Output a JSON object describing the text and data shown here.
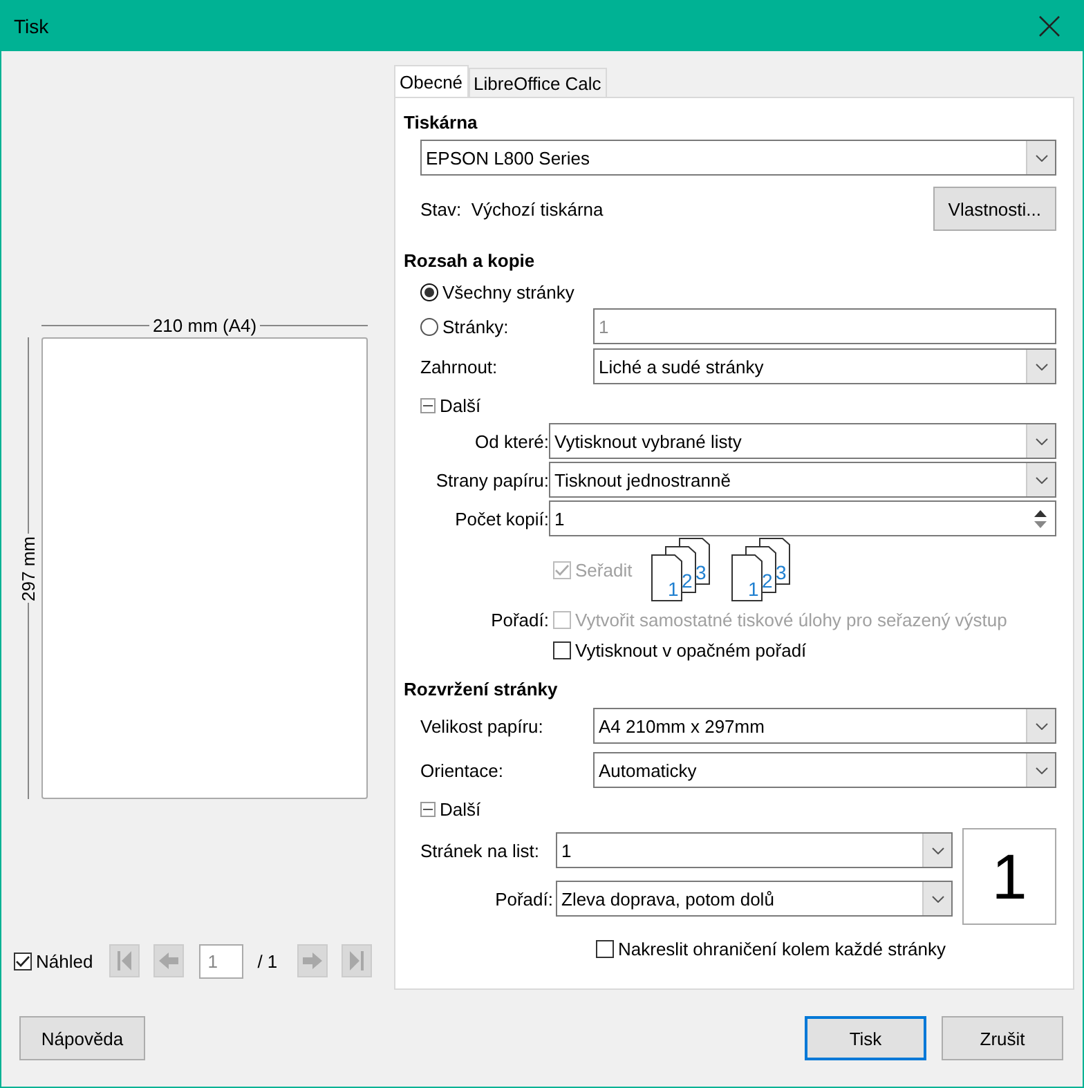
{
  "window": {
    "title": "Tisk"
  },
  "preview": {
    "width_label": "210 mm (A4)",
    "height_label": "297 mm",
    "show_preview": {
      "label": "Náhled",
      "checked": true
    },
    "page_field": "1",
    "page_total": "/ 1",
    "nav_buttons": [
      {
        "kind": "first",
        "disabled": true
      },
      {
        "kind": "prev",
        "disabled": true
      },
      {
        "kind": "next",
        "disabled": true
      },
      {
        "kind": "last",
        "disabled": true
      }
    ]
  },
  "tabs": [
    {
      "label": "Obecné",
      "selected": true
    },
    {
      "label": "LibreOffice Calc",
      "selected": false
    }
  ],
  "printer": {
    "heading": "Tiskárna",
    "device": "EPSON L800 Series",
    "status_label": "Stav:",
    "status": "Výchozí tiskárna",
    "properties_button": "Vlastnosti..."
  },
  "range": {
    "heading": "Rozsah a kopie",
    "options": [
      {
        "label": "Všechny stránky",
        "selected": true
      },
      {
        "label": "Stránky:",
        "selected": false,
        "value": "1"
      }
    ],
    "include": {
      "label": "Zahrnout:",
      "value": "Liché a sudé stránky"
    },
    "more": {
      "label": "Další",
      "expanded": true
    },
    "fields": [
      {
        "kind": "dropdown",
        "label": "Od které:",
        "value": "Vytisknout vybrané listy"
      },
      {
        "kind": "dropdown",
        "label": "Strany papíru:",
        "value": "Tisknout jednostranně"
      },
      {
        "kind": "spin",
        "label": "Počet kopií:",
        "value": "1"
      }
    ],
    "collate": {
      "label": "Seřadit",
      "checked": true,
      "disabled": true
    },
    "collate_icons": [
      {
        "pages": [
          "1",
          "2",
          "3"
        ]
      },
      {
        "pages": [
          "1",
          "2",
          "3"
        ]
      }
    ],
    "order_label": "Pořadí:",
    "order_options": [
      {
        "label": "Vytvořit samostatné tiskové úlohy pro seřazený výstup",
        "checked": false,
        "disabled": true
      },
      {
        "label": "Vytisknout v opačném pořadí",
        "checked": false,
        "disabled": false
      }
    ]
  },
  "layout": {
    "heading": "Rozvržení stránky",
    "fields": [
      {
        "label": "Velikost papíru:",
        "value": "A4 210mm x 297mm"
      },
      {
        "label": "Orientace:",
        "value": "Automaticky"
      }
    ],
    "more": {
      "label": "Další",
      "expanded": true
    },
    "pages_per_sheet": {
      "label": "Stránek na list:",
      "value": "1"
    },
    "order": {
      "label": "Pořadí:",
      "value": "Zleva doprava, potom dolů"
    },
    "sheet_preview": "1",
    "border_option": {
      "label": "Nakreslit ohraničení kolem každé stránky",
      "checked": false
    }
  },
  "buttons": [
    {
      "kind": "help",
      "label": "Nápověda"
    },
    {
      "kind": "primary",
      "label": "Tisk"
    },
    {
      "kind": "cancel",
      "label": "Zrušit"
    }
  ]
}
